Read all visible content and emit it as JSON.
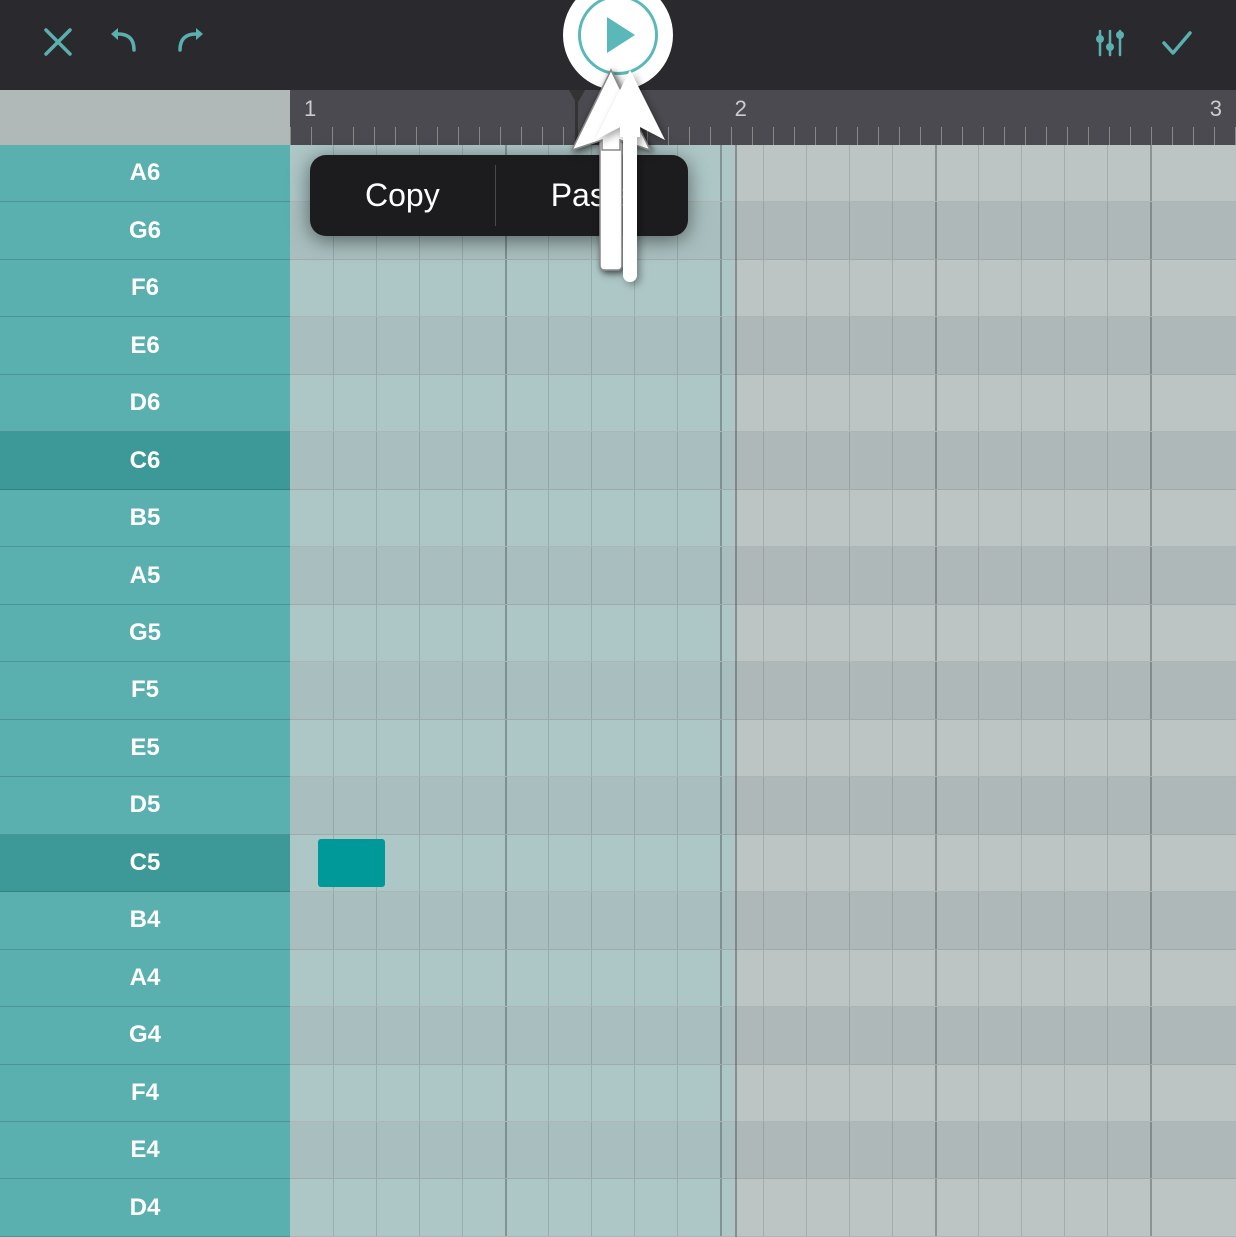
{
  "toolbar": {
    "close_label": "✕",
    "undo_label": "↩",
    "redo_label": "↪",
    "settings_label": "⚙",
    "check_label": "✓"
  },
  "ruler": {
    "labels": [
      {
        "text": "1",
        "offset_pct": 2
      },
      {
        "text": "2",
        "offset_pct": 48
      },
      {
        "text": "3",
        "offset_pct": 94
      }
    ]
  },
  "context_menu": {
    "copy_label": "Copy",
    "paste_label": "Paste"
  },
  "notes": [
    {
      "label": "A6",
      "type": "white"
    },
    {
      "label": "G6",
      "type": "white"
    },
    {
      "label": "F6",
      "type": "white"
    },
    {
      "label": "E6",
      "type": "white"
    },
    {
      "label": "D6",
      "type": "white"
    },
    {
      "label": "C6",
      "type": "c-note"
    },
    {
      "label": "B5",
      "type": "white"
    },
    {
      "label": "A5",
      "type": "white"
    },
    {
      "label": "G5",
      "type": "white"
    },
    {
      "label": "F5",
      "type": "white"
    },
    {
      "label": "E5",
      "type": "white"
    },
    {
      "label": "D5",
      "type": "white"
    },
    {
      "label": "C5",
      "type": "c-note"
    },
    {
      "label": "B4",
      "type": "white"
    },
    {
      "label": "A4",
      "type": "white"
    },
    {
      "label": "G4",
      "type": "white"
    },
    {
      "label": "F4",
      "type": "white"
    },
    {
      "label": "E4",
      "type": "white"
    },
    {
      "label": "D4",
      "type": "white"
    }
  ],
  "colors": {
    "teal": "#5aafaf",
    "dark_teal": "#3d9898",
    "note_block": "#009999",
    "toolbar_bg": "#2a2a2e",
    "grid_light": "#c5cece",
    "grid_dark": "#b8c2c2"
  }
}
